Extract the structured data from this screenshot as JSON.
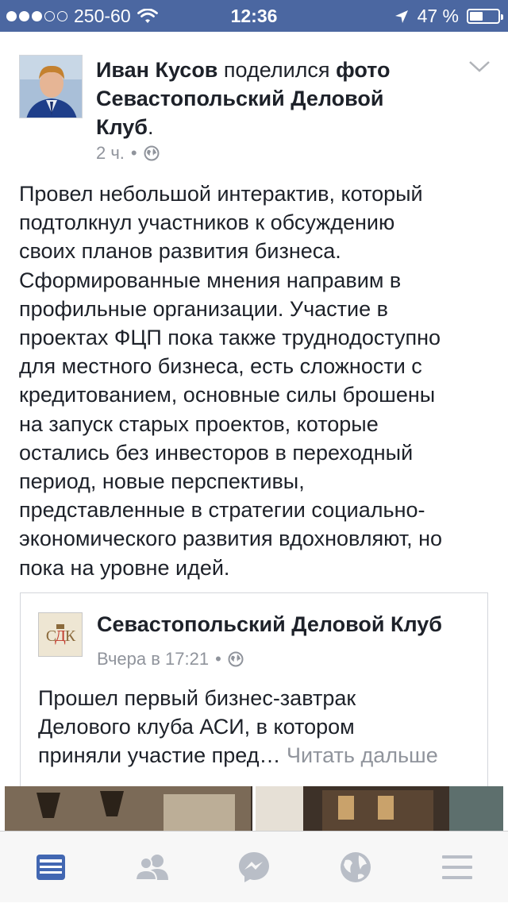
{
  "status_bar": {
    "carrier": "250-60",
    "time": "12:36",
    "battery": "47 %",
    "battery_level": 0.47,
    "signal_bars_filled": 3
  },
  "post": {
    "author": "Иван Кусов",
    "action": "поделился",
    "object": "фото",
    "target_line1": "Севастопольский Деловой",
    "target_line2": "Клуб",
    "time": "2 ч.",
    "separator": "•",
    "privacy_icon": "globe-icon",
    "text_lines": [
      "Провел небольшой интерактив, который",
      "подтолкнул участников к обсуждению",
      "своих планов развития бизнеса.",
      "Сформированные мнения направим в",
      "профильные организации. Участие в",
      "проектах ФЦП пока также труднодоступно",
      "для местного бизнеса, есть сложности с",
      "кредитованием, основные силы брошены",
      "на запуск старых проектов, которые",
      "остались без инвесторов в переходный",
      "период, новые перспективы,",
      "представленные в стратегии социально-",
      "экономического развития вдохновляют, но",
      "пока на уровне идей."
    ]
  },
  "shared_post": {
    "avatar_text": "СДК",
    "page_name": "Севастопольский Деловой Клуб",
    "time": "Вчера в 17:21",
    "separator": "•",
    "text_line1": "Прошел первый бизнес-завтрак",
    "text_line2": "Делового клуба АСИ, в котором",
    "text_line3": "приняли участие пред…",
    "read_more": "Читать дальше"
  },
  "tab_bar": {
    "tabs": [
      {
        "name": "news-feed",
        "icon": "news-feed-icon",
        "active": true
      },
      {
        "name": "friends",
        "icon": "friends-icon",
        "active": false
      },
      {
        "name": "messenger",
        "icon": "messenger-icon",
        "active": false
      },
      {
        "name": "notifications",
        "icon": "globe-icon",
        "active": false
      },
      {
        "name": "more",
        "icon": "menu-icon",
        "active": false
      }
    ]
  },
  "colors": {
    "status_bar": "#4b67a1",
    "active_tab": "#4267b2",
    "inactive_tab": "#b9bec7",
    "text": "#1d2129",
    "secondary_text": "#90949c"
  }
}
